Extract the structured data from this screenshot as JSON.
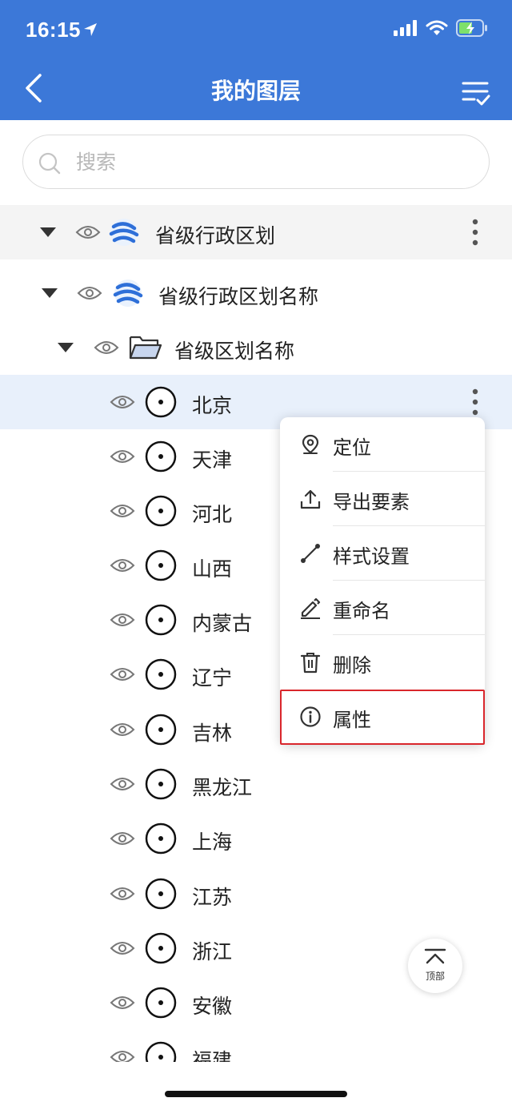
{
  "status": {
    "time": "16:15"
  },
  "header": {
    "title": "我的图层",
    "back_icon": "chevron-left-icon",
    "manage_icon": "list-check-icon"
  },
  "search": {
    "placeholder": "搜索",
    "value": ""
  },
  "tree": {
    "group_layer": {
      "label": "省级行政区划"
    },
    "sub_layer": {
      "label": "省级行政区划名称"
    },
    "folder": {
      "label": "省级区划名称"
    },
    "items": [
      {
        "label": "北京"
      },
      {
        "label": "天津"
      },
      {
        "label": "河北"
      },
      {
        "label": "山西"
      },
      {
        "label": "内蒙古"
      },
      {
        "label": "辽宁"
      },
      {
        "label": "吉林"
      },
      {
        "label": "黑龙江"
      },
      {
        "label": "上海"
      },
      {
        "label": "江苏"
      },
      {
        "label": "浙江"
      },
      {
        "label": "安徽"
      },
      {
        "label": "福建"
      }
    ]
  },
  "context_menu": {
    "items": [
      {
        "label": "定位",
        "icon": "location-pin-icon"
      },
      {
        "label": "导出要素",
        "icon": "upload-icon"
      },
      {
        "label": "样式设置",
        "icon": "line-style-icon"
      },
      {
        "label": "重命名",
        "icon": "pencil-icon"
      },
      {
        "label": "删除",
        "icon": "trash-icon"
      },
      {
        "label": "属性",
        "icon": "info-icon"
      }
    ],
    "highlighted": "属性"
  },
  "back_to_top": {
    "label": "顶部"
  },
  "colors": {
    "header": "#3c78d8",
    "highlight_border": "#d9262c",
    "selected_row": "#e8f0fb"
  }
}
